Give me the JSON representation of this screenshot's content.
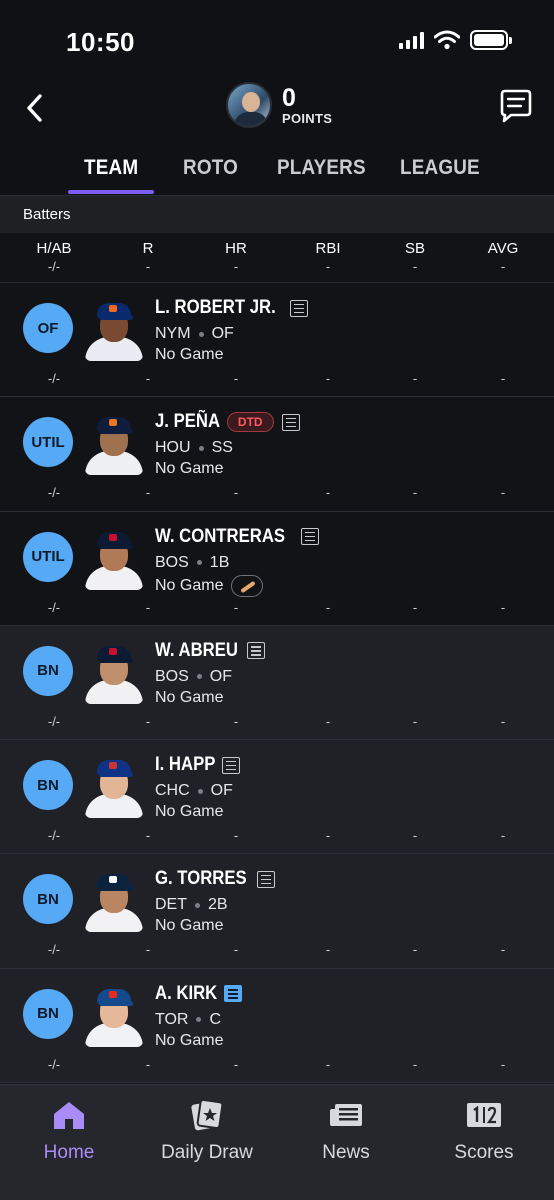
{
  "status_bar": {
    "time": "10:50"
  },
  "header": {
    "points_value": "0",
    "points_label": "POINTS"
  },
  "tabs": [
    {
      "label": "TEAM",
      "active": true
    },
    {
      "label": "ROTO",
      "active": false
    },
    {
      "label": "PLAYERS",
      "active": false
    },
    {
      "label": "LEAGUE",
      "active": false
    }
  ],
  "section": {
    "title": "Batters",
    "stat_headers": [
      "H/AB",
      "R",
      "HR",
      "RBI",
      "SB",
      "AVG"
    ],
    "totals": [
      "-/-",
      "-",
      "-",
      "-",
      "-",
      "-"
    ]
  },
  "players": [
    {
      "pos": "OF",
      "name": "L. ROBERT JR.",
      "team": "NYM",
      "player_pos": "OF",
      "game": "No Game",
      "status": "",
      "stats": [
        "-/-",
        "-",
        "-",
        "-",
        "-",
        "-"
      ],
      "bench": false,
      "cap_color": "#0a2a6e",
      "logo_color": "#f26a22",
      "jersey_color": "#e9ecf2",
      "skin": "#7a4a32"
    },
    {
      "pos": "UTIL",
      "name": "J. PEÑA",
      "team": "HOU",
      "player_pos": "SS",
      "game": "No Game",
      "status": "DTD",
      "stats": [
        "-/-",
        "-",
        "-",
        "-",
        "-",
        "-"
      ],
      "bench": false,
      "cap_color": "#0f1c3d",
      "logo_color": "#e87722",
      "jersey_color": "#eef0f4",
      "skin": "#a0714f"
    },
    {
      "pos": "UTIL",
      "name": "W. CONTRERAS",
      "team": "BOS",
      "player_pos": "1B",
      "game": "No Game",
      "status": "",
      "stats": [
        "-/-",
        "-",
        "-",
        "-",
        "-",
        "-"
      ],
      "bench": false,
      "cap_color": "#0d1a33",
      "logo_color": "#c8102e",
      "jersey_color": "#f1f1f3",
      "skin": "#b07a56"
    },
    {
      "pos": "BN",
      "name": "W. ABREU",
      "team": "BOS",
      "player_pos": "OF",
      "game": "No Game",
      "status": "",
      "stats": [
        "-/-",
        "-",
        "-",
        "-",
        "-",
        "-"
      ],
      "bench": true,
      "cap_color": "#0d1a33",
      "logo_color": "#c8102e",
      "jersey_color": "#f1f1f3",
      "skin": "#c08f6c"
    },
    {
      "pos": "BN",
      "name": "I. HAPP",
      "team": "CHC",
      "player_pos": "OF",
      "game": "No Game",
      "status": "",
      "stats": [
        "-/-",
        "-",
        "-",
        "-",
        "-",
        "-"
      ],
      "bench": true,
      "cap_color": "#0e3386",
      "logo_color": "#cc3433",
      "jersey_color": "#eef1f6",
      "skin": "#e2b596"
    },
    {
      "pos": "BN",
      "name": "G. TORRES",
      "team": "DET",
      "player_pos": "2B",
      "game": "No Game",
      "status": "",
      "stats": [
        "-/-",
        "-",
        "-",
        "-",
        "-",
        "-"
      ],
      "bench": true,
      "cap_color": "#0c2340",
      "logo_color": "#ffffff",
      "jersey_color": "#f2f2f4",
      "skin": "#b98563"
    },
    {
      "pos": "BN",
      "name": "A. KIRK",
      "team": "TOR",
      "player_pos": "C",
      "game": "No Game",
      "status": "",
      "stats": [
        "-/-",
        "-",
        "-",
        "-",
        "-",
        "-"
      ],
      "bench": true,
      "cap_color": "#134a8e",
      "logo_color": "#e8291c",
      "jersey_color": "#f0f2f6",
      "skin": "#e5b89a",
      "note_highlight": true
    }
  ],
  "bottom_nav": [
    {
      "label": "Home",
      "icon": "home-icon",
      "active": true
    },
    {
      "label": "Daily Draw",
      "icon": "daily-draw-icon",
      "active": false
    },
    {
      "label": "News",
      "icon": "news-icon",
      "active": false
    },
    {
      "label": "Scores",
      "icon": "scores-icon",
      "active": false
    }
  ],
  "colors": {
    "accent": "#7b5cf5",
    "position_badge": "#56a9f5",
    "dtd": "#ff5a5f",
    "nav_active": "#a98cf8"
  }
}
